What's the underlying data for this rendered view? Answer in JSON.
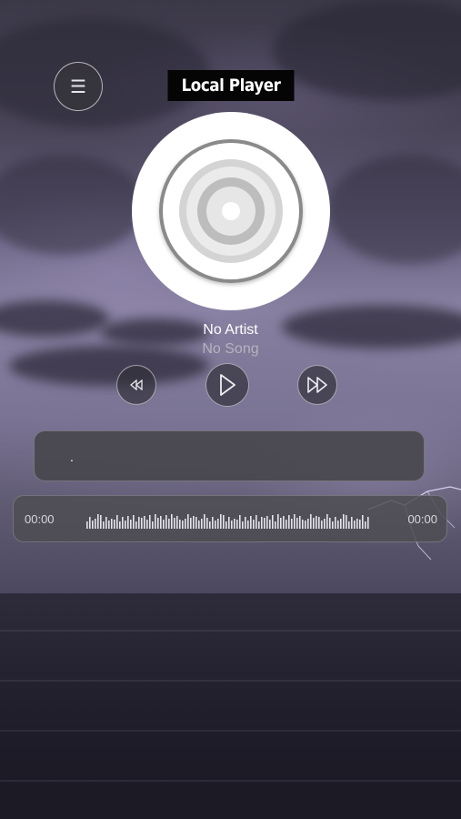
{
  "header": {
    "title": "Local Player",
    "menu_icon": "☰"
  },
  "track": {
    "artist": "No Artist",
    "song": "No Song"
  },
  "controls": {
    "previous_icon": "rewind-icon",
    "play_icon": "play-icon",
    "next_icon": "fast-forward-icon"
  },
  "lyrics": {
    "text": "."
  },
  "progress": {
    "current_time": "00:00",
    "total_time": "00:00",
    "position": 0
  },
  "colors": {
    "title_bg": "#050505",
    "panel_bg": "#46444a",
    "text_primary": "#ffffff",
    "text_secondary": "#b5b3bd"
  }
}
